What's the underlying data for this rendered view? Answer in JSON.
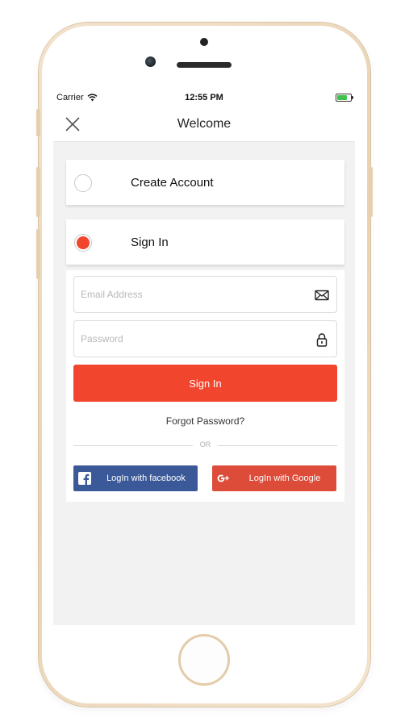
{
  "status_bar": {
    "carrier": "Carrier",
    "time": "12:55 PM",
    "battery_level": 0.75,
    "battery_color": "#3fc34a"
  },
  "nav": {
    "title": "Welcome",
    "close_icon": "close-icon"
  },
  "options": [
    {
      "label": "Create Account",
      "selected": false
    },
    {
      "label": "Sign In",
      "selected": true
    }
  ],
  "form": {
    "email_placeholder": "Email Address",
    "email_value": "",
    "email_icon": "envelope-icon",
    "password_placeholder": "Password",
    "password_value": "",
    "password_icon": "lock-icon",
    "submit_label": "Sign In",
    "forgot_label": "Forgot Password?",
    "divider_label": "OR"
  },
  "social": {
    "facebook_label": "LogIn with facebook",
    "facebook_icon": "facebook-icon",
    "google_label": "LogIn with Google",
    "google_icon": "google-plus-icon"
  },
  "colors": {
    "accent": "#f2452e",
    "facebook": "#3b5998",
    "google": "#dd4b39",
    "background": "#f2f2f2"
  }
}
